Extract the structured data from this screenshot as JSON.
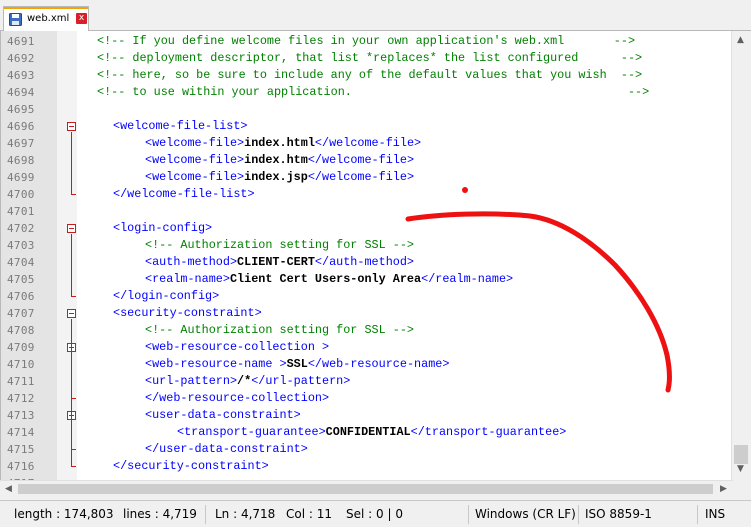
{
  "tab": {
    "file_name": "web.xml",
    "close_label": "x",
    "icon": "save-disk-icon"
  },
  "lines": [
    {
      "n": "4691",
      "indent": 0,
      "parts": [
        [
          "comment",
          "<!-- If you define welcome files in your own application's web.xml       -->"
        ]
      ]
    },
    {
      "n": "4692",
      "indent": 0,
      "parts": [
        [
          "comment",
          "<!-- deployment descriptor, that list *replaces* the list configured      -->"
        ]
      ]
    },
    {
      "n": "4693",
      "indent": 0,
      "parts": [
        [
          "comment",
          "<!-- here, so be sure to include any of the default values that you wish  -->"
        ]
      ]
    },
    {
      "n": "4694",
      "indent": 0,
      "parts": [
        [
          "comment",
          "<!-- to use within your application.                                       -->"
        ]
      ]
    },
    {
      "n": "4695",
      "indent": 0,
      "parts": []
    },
    {
      "n": "4696",
      "indent": 1,
      "parts": [
        [
          "tag",
          "<welcome-file-list>"
        ]
      ]
    },
    {
      "n": "4697",
      "indent": 2,
      "parts": [
        [
          "tag",
          "<welcome-file>"
        ],
        [
          "txt",
          "index.html"
        ],
        [
          "tag",
          "</welcome-file>"
        ]
      ]
    },
    {
      "n": "4698",
      "indent": 2,
      "parts": [
        [
          "tag",
          "<welcome-file>"
        ],
        [
          "txt",
          "index.htm"
        ],
        [
          "tag",
          "</welcome-file>"
        ]
      ]
    },
    {
      "n": "4699",
      "indent": 2,
      "parts": [
        [
          "tag",
          "<welcome-file>"
        ],
        [
          "txt",
          "index.jsp"
        ],
        [
          "tag",
          "</welcome-file>"
        ]
      ]
    },
    {
      "n": "4700",
      "indent": 1,
      "parts": [
        [
          "tag",
          "</welcome-file-list>"
        ]
      ]
    },
    {
      "n": "4701",
      "indent": 0,
      "parts": []
    },
    {
      "n": "4702",
      "indent": 1,
      "parts": [
        [
          "tag",
          "<login-config>"
        ]
      ]
    },
    {
      "n": "4703",
      "indent": 2,
      "parts": [
        [
          "comment",
          "<!-- Authorization setting for SSL -->"
        ]
      ]
    },
    {
      "n": "4704",
      "indent": 2,
      "parts": [
        [
          "tag",
          "<auth-method>"
        ],
        [
          "txt",
          "CLIENT-CERT"
        ],
        [
          "tag",
          "</auth-method>"
        ]
      ]
    },
    {
      "n": "4705",
      "indent": 2,
      "parts": [
        [
          "tag",
          "<realm-name>"
        ],
        [
          "txt",
          "Client Cert Users-only Area"
        ],
        [
          "tag",
          "</realm-name>"
        ]
      ]
    },
    {
      "n": "4706",
      "indent": 1,
      "parts": [
        [
          "tag",
          "</login-config>"
        ]
      ]
    },
    {
      "n": "4707",
      "indent": 1,
      "parts": [
        [
          "tag",
          "<security-constraint>"
        ]
      ]
    },
    {
      "n": "4708",
      "indent": 2,
      "parts": [
        [
          "comment",
          "<!-- Authorization setting for SSL -->"
        ]
      ]
    },
    {
      "n": "4709",
      "indent": 2,
      "parts": [
        [
          "tag",
          "<web-resource-collection >"
        ]
      ]
    },
    {
      "n": "4710",
      "indent": 2,
      "parts": [
        [
          "tag",
          "<web-resource-name >"
        ],
        [
          "txt",
          "SSL"
        ],
        [
          "tag",
          "</web-resource-name>"
        ]
      ]
    },
    {
      "n": "4711",
      "indent": 2,
      "parts": [
        [
          "tag",
          "<url-pattern>"
        ],
        [
          "txt",
          "/*"
        ],
        [
          "tag",
          "</url-pattern>"
        ]
      ]
    },
    {
      "n": "4712",
      "indent": 2,
      "parts": [
        [
          "tag",
          "</web-resource-collection>"
        ]
      ]
    },
    {
      "n": "4713",
      "indent": 2,
      "parts": [
        [
          "tag",
          "<user-data-constraint>"
        ]
      ]
    },
    {
      "n": "4714",
      "indent": 3,
      "parts": [
        [
          "tag",
          "<transport-guarantee>"
        ],
        [
          "txt",
          "CONFIDENTIAL"
        ],
        [
          "tag",
          "</transport-guarantee>"
        ]
      ]
    },
    {
      "n": "4715",
      "indent": 2,
      "parts": [
        [
          "tag",
          "</user-data-constraint>"
        ]
      ]
    },
    {
      "n": "4716",
      "indent": 1,
      "parts": [
        [
          "tag",
          "</security-constraint>"
        ]
      ]
    },
    {
      "n": "4717",
      "indent": 0,
      "parts": []
    }
  ],
  "status": {
    "length": "length : 174,803",
    "lines": "lines : 4,719",
    "ln": "Ln : 4,718",
    "col": "Col : 11",
    "sel": "Sel : 0 | 0",
    "eol": "Windows (CR LF)",
    "encoding": "ISO 8859-1",
    "mode": "INS"
  },
  "colors": {
    "comment": "#008000",
    "tag": "#0000ff",
    "text": "#000000",
    "fold": "#c51d1d",
    "annotation": "#ee1111"
  }
}
